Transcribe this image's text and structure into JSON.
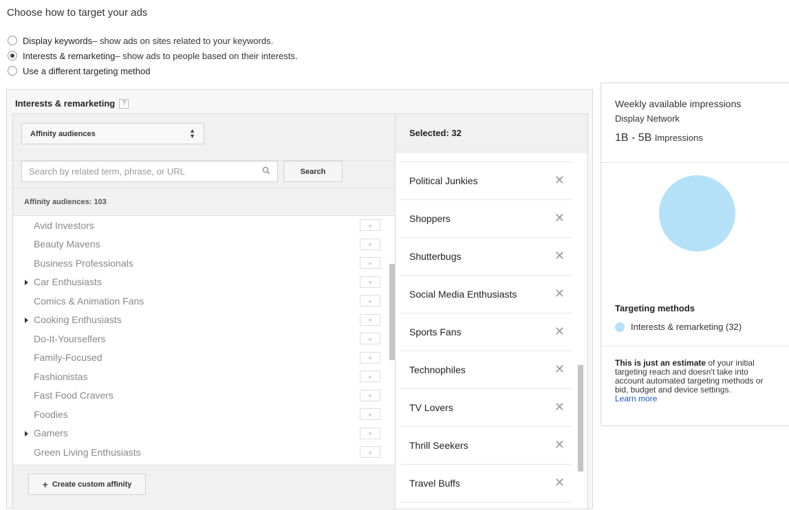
{
  "page": {
    "title": "Choose how to target your ads"
  },
  "targeting_options": [
    {
      "label": "Display keywords",
      "desc": " – show ads on sites related to your keywords.",
      "checked": false
    },
    {
      "label": "Interests & remarketing",
      "desc": " – show ads to people based on their interests.",
      "checked": true
    },
    {
      "label": "Use a different targeting method",
      "desc": "",
      "checked": false
    }
  ],
  "panel": {
    "header": "Interests & remarketing",
    "help": "?",
    "dropdown_value": "Affinity audiences",
    "search_placeholder": "Search by related term, phrase, or URL",
    "search_button": "Search",
    "audience_count": "Affinity audiences: 103",
    "create_button": "Create custom affinity",
    "audiences": [
      {
        "label": "Avid Investors",
        "expandable": false
      },
      {
        "label": "Beauty Mavens",
        "expandable": false
      },
      {
        "label": "Business Professionals",
        "expandable": false
      },
      {
        "label": "Car Enthusiasts",
        "expandable": true
      },
      {
        "label": "Comics & Animation Fans",
        "expandable": false
      },
      {
        "label": "Cooking Enthusiasts",
        "expandable": true
      },
      {
        "label": "Do-It-Yourselfers",
        "expandable": false
      },
      {
        "label": "Family-Focused",
        "expandable": false
      },
      {
        "label": "Fashionistas",
        "expandable": false
      },
      {
        "label": "Fast Food Cravers",
        "expandable": false
      },
      {
        "label": "Foodies",
        "expandable": false
      },
      {
        "label": "Gamers",
        "expandable": true
      },
      {
        "label": "Green Living Enthusiasts",
        "expandable": false
      }
    ],
    "add_symbol": "»",
    "selected_heading": "Selected: 32",
    "selected": [
      "Political Junkies",
      "Shoppers",
      "Shutterbugs",
      "Social Media Enthusiasts",
      "Sports Fans",
      "Technophiles",
      "TV Lovers",
      "Thrill Seekers",
      "Travel Buffs"
    ],
    "remove_symbol": "✕"
  },
  "estimate": {
    "title": "Weekly available impressions",
    "network": "Display Network",
    "range": "1B - 5B",
    "unit": "Impressions",
    "methods_title": "Targeting methods",
    "method_label": "Interests & remarketing (32)",
    "note_bold": "This is just an estimate",
    "note_rest": " of your initial targeting reach and doesn't take into account automated targeting methods or bid, budget and device settings.",
    "learn_more": "Learn more",
    "pie_color": "#b4e1f8"
  }
}
